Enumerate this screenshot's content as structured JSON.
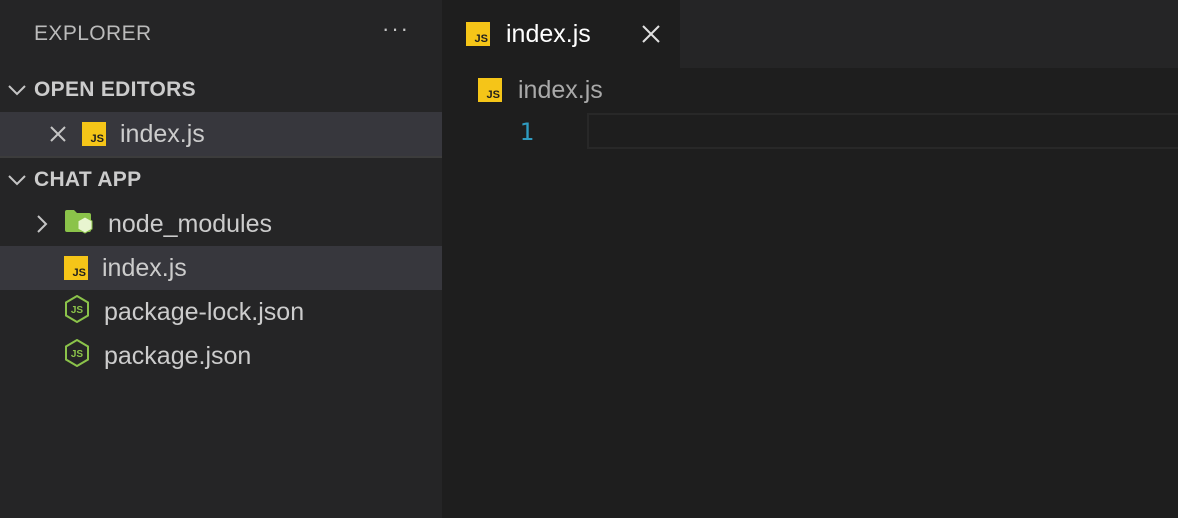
{
  "sidebar": {
    "title": "EXPLORER",
    "more_actions_label": "···",
    "open_editors": {
      "label": "OPEN EDITORS",
      "items": [
        {
          "label": "index.js",
          "icon": "js-file-icon"
        }
      ]
    },
    "project": {
      "label": "CHAT APP",
      "items": [
        {
          "label": "node_modules",
          "icon": "folder-node-icon",
          "type": "folder"
        },
        {
          "label": "index.js",
          "icon": "js-file-icon",
          "type": "file"
        },
        {
          "label": "package-lock.json",
          "icon": "node-json-icon",
          "type": "file"
        },
        {
          "label": "package.json",
          "icon": "node-json-icon",
          "type": "file"
        }
      ]
    }
  },
  "editor": {
    "tab": {
      "label": "index.js",
      "icon": "js-file-icon"
    },
    "breadcrumb": {
      "label": "index.js"
    },
    "lines": [
      {
        "number": "1",
        "content": ""
      }
    ]
  },
  "colors": {
    "sidebar_bg": "#252526",
    "editor_bg": "#1e1e1e",
    "selection_bg": "#37373d",
    "js_icon": "#f5c518",
    "node_green": "#8bc34a",
    "line_number": "#2f9bc0"
  }
}
